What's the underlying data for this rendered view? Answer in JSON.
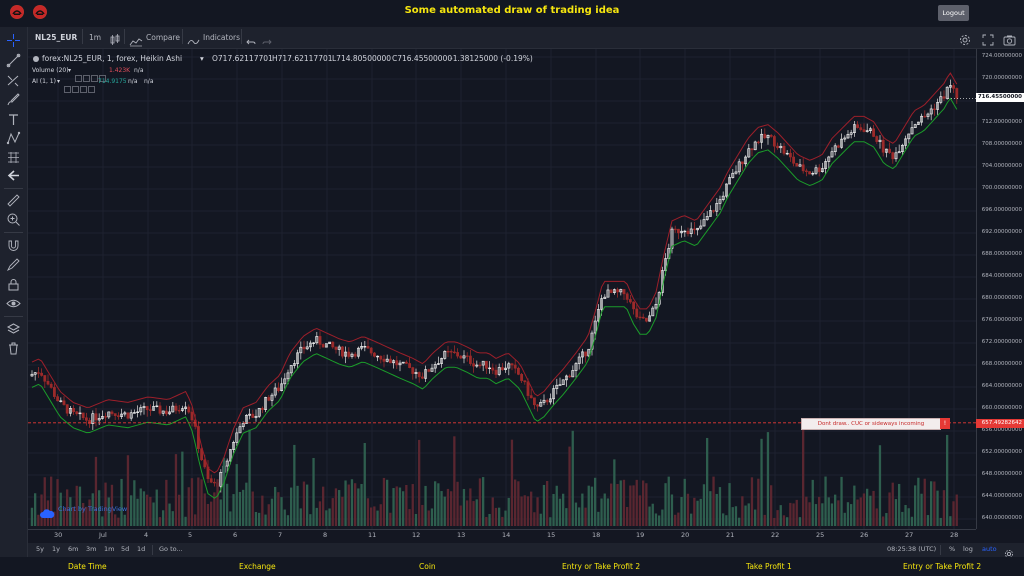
{
  "app": {
    "title": "Some automated draw of trading idea",
    "logout_label": "Logout"
  },
  "toolbar": {
    "symbol": "NL25_EUR",
    "interval": "1m",
    "compare_label": "Compare",
    "indicators_label": "Indicators"
  },
  "legend": {
    "series_title": "forex:NL25_EUR, 1, forex, Heikin Ashi",
    "open": "O717.62117701",
    "high": "H717.62117701",
    "low": "L714.80500000",
    "close": "C716.45500000",
    "change": "-1.38125000 (-0.19%)",
    "volume_label": "Volume (20)",
    "volume_value": "1.423K",
    "volume_na": "n/a",
    "ai_label": "AI (1, 1)",
    "ai_value": "714.9175",
    "ai_na1": "n/a",
    "ai_na2": "n/a"
  },
  "price_axis": {
    "ticks": [
      "724.00000000",
      "720.00000000",
      "716.00000000",
      "712.00000000",
      "708.00000000",
      "704.00000000",
      "700.00000000",
      "696.00000000",
      "692.00000000",
      "688.00000000",
      "684.00000000",
      "680.00000000",
      "676.00000000",
      "672.00000000",
      "668.00000000",
      "664.00000000",
      "660.00000000",
      "656.00000000",
      "652.00000000",
      "648.00000000",
      "644.00000000",
      "640.00000000"
    ],
    "last_price": "716.45500000",
    "alert_price": "657.49282642"
  },
  "annotation": {
    "text": "Dont draw.. CUC or sideways incoming",
    "badge": "!"
  },
  "time_axis": {
    "labels": [
      "30",
      "Jul",
      "4",
      "5",
      "6",
      "7",
      "8",
      "11",
      "12",
      "13",
      "14",
      "15",
      "18",
      "19",
      "20",
      "21",
      "22",
      "25",
      "26",
      "27",
      "28"
    ]
  },
  "bottom_bar": {
    "ranges": [
      "5y",
      "1y",
      "6m",
      "3m",
      "1m",
      "5d",
      "1d"
    ],
    "goto_label": "Go to...",
    "clock": "08:25:38 (UTC)",
    "percent": "%",
    "log": "log",
    "auto": "auto"
  },
  "watermark": "Chart by TradingView",
  "footer": {
    "columns": [
      "Date Time",
      "Exchange",
      "Coin",
      "Entry or Take Profit 2",
      "Take Profit 1",
      "Entry or Take Profit 2"
    ]
  },
  "colors": {
    "accent_yellow": "#f6e60f",
    "up_candle": "#ffffff",
    "down_candle": "#9c2a2a",
    "upper_band": "#9c1f2a",
    "lower_band": "#1b9c2a",
    "alert": "#e53935",
    "autolabel": "#2962ff"
  }
}
